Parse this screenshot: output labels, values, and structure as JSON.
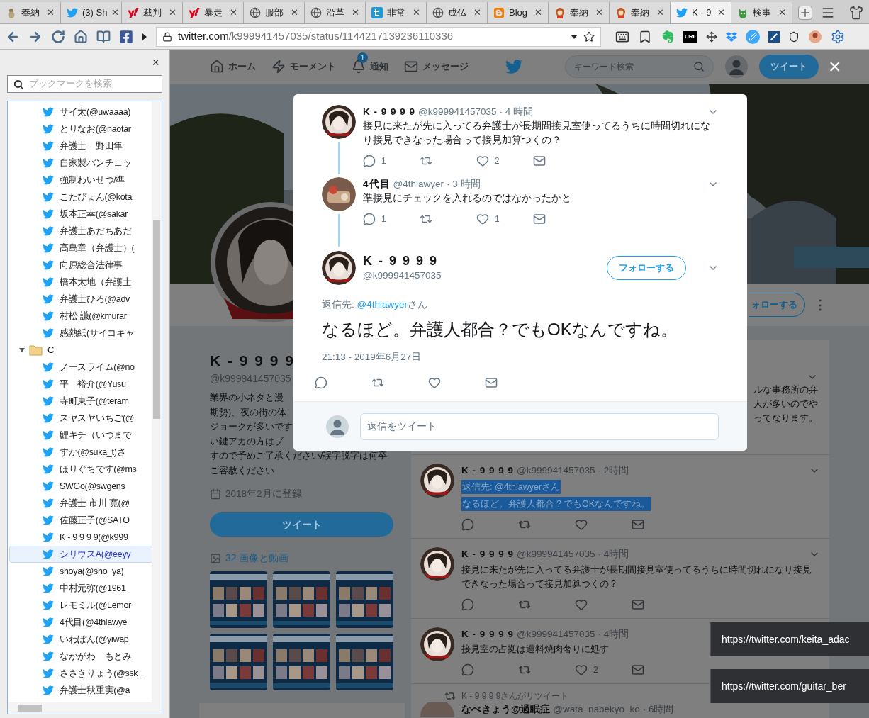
{
  "browser": {
    "tabs": [
      {
        "title": "奉納",
        "kind": "gourd",
        "close": "✕",
        "selected": false
      },
      {
        "title": "(3) Sh",
        "kind": "bird",
        "close": "✕",
        "selected": false
      },
      {
        "title": "裁判",
        "kind": "yahoo",
        "close": "✕",
        "selected": false
      },
      {
        "title": "暴走",
        "kind": "yahoo",
        "close": "✕",
        "selected": false
      },
      {
        "title": "服部",
        "kind": "globe",
        "close": "✕",
        "selected": false
      },
      {
        "title": "沿革",
        "kind": "globe",
        "close": "✕",
        "selected": false
      },
      {
        "title": "非常",
        "kind": "square",
        "close": "✕",
        "selected": false
      },
      {
        "title": "成仏",
        "kind": "globe",
        "close": "✕",
        "selected": false
      },
      {
        "title": "Blog",
        "kind": "blogger",
        "close": "✕",
        "selected": false
      },
      {
        "title": "奉納",
        "kind": "girl",
        "close": "✕",
        "selected": false
      },
      {
        "title": "奉納",
        "kind": "girl",
        "close": "✕",
        "selected": false
      },
      {
        "title": "K - 9",
        "kind": "bird",
        "close": "✕",
        "selected": true
      },
      {
        "title": "検事",
        "kind": "green",
        "close": "✕",
        "selected": false
      }
    ],
    "url": {
      "host": "twitter.com",
      "path": "/k999941457035/status/1144217139236110336"
    },
    "extension_label": "URL"
  },
  "sidebar": {
    "close": "×",
    "search_placeholder": "ブックマークを検索",
    "items": [
      {
        "kind": "bookmark",
        "label": "サイ太(@uwaaaa)",
        "selected": false
      },
      {
        "kind": "bookmark",
        "label": "とりなお(@naotar",
        "selected": false
      },
      {
        "kind": "bookmark",
        "label": "弁護士　野田隼",
        "selected": false
      },
      {
        "kind": "bookmark",
        "label": "自家製パンチェッ",
        "selected": false
      },
      {
        "kind": "bookmark",
        "label": "強制わいせつ/準",
        "selected": false
      },
      {
        "kind": "bookmark",
        "label": "こたぴょん(@kota",
        "selected": false
      },
      {
        "kind": "bookmark",
        "label": "坂本正幸(@sakar",
        "selected": false
      },
      {
        "kind": "bookmark",
        "label": "弁護士あだちあだ",
        "selected": false
      },
      {
        "kind": "bookmark",
        "label": "高島章（弁護士）(",
        "selected": false
      },
      {
        "kind": "bookmark",
        "label": "向原総合法律事",
        "selected": false
      },
      {
        "kind": "bookmark",
        "label": "橋本太地（弁護士",
        "selected": false
      },
      {
        "kind": "bookmark",
        "label": "弁護士ひろ(@adv",
        "selected": false
      },
      {
        "kind": "bookmark",
        "label": "村松 謙(@kmurar",
        "selected": false
      },
      {
        "kind": "bookmark",
        "label": "感熱紙(サイコキャ",
        "selected": false
      },
      {
        "kind": "folder",
        "label": "C",
        "expanded": true,
        "children": [
          {
            "kind": "bookmark",
            "label": "ノースライム(@no",
            "selected": false
          },
          {
            "kind": "bookmark",
            "label": "平　裕介(@Yusu",
            "selected": false
          },
          {
            "kind": "bookmark",
            "label": "寺町東子(@teram",
            "selected": false
          },
          {
            "kind": "bookmark",
            "label": "スヤスヤいちご(@",
            "selected": false
          },
          {
            "kind": "bookmark",
            "label": "鯉キチ（いつまで",
            "selected": false
          },
          {
            "kind": "bookmark",
            "label": "すか(@suka_t)さ",
            "selected": false
          },
          {
            "kind": "bookmark",
            "label": "ほりぐちです(@ms",
            "selected": false
          },
          {
            "kind": "bookmark",
            "label": "SWGo(@swgens",
            "selected": false
          },
          {
            "kind": "bookmark",
            "label": "弁護士 市川 寛(@",
            "selected": false
          },
          {
            "kind": "bookmark",
            "label": "佐藤正子(@SATO",
            "selected": false
          },
          {
            "kind": "bookmark",
            "label": "K - 9 9 9 9(@k999",
            "selected": false
          },
          {
            "kind": "bookmark",
            "label": "シリウスA(@eeyy",
            "selected": true
          },
          {
            "kind": "bookmark",
            "label": "shoya(@sho_ya)",
            "selected": false
          },
          {
            "kind": "bookmark",
            "label": "中村元弥(@1961",
            "selected": false
          },
          {
            "kind": "bookmark",
            "label": "レモミル(@Lemor",
            "selected": false
          },
          {
            "kind": "bookmark",
            "label": "4代目(@4thlawye",
            "selected": false
          },
          {
            "kind": "bookmark",
            "label": "いわぽん(@yiwap",
            "selected": false
          },
          {
            "kind": "bookmark",
            "label": "なかがわ　もとみ",
            "selected": false
          },
          {
            "kind": "bookmark",
            "label": "ささきりょう(@ssk_",
            "selected": false
          },
          {
            "kind": "bookmark",
            "label": "弁護士秋重実(@a",
            "selected": false
          }
        ]
      }
    ]
  },
  "twitter_nav": {
    "items": [
      {
        "label": "ホーム",
        "kind": "home"
      },
      {
        "label": "モーメント",
        "kind": "bolt"
      },
      {
        "label": "通知",
        "kind": "bell",
        "badge": "1"
      },
      {
        "label": "メッセージ",
        "kind": "mail"
      }
    ],
    "search_placeholder": "キーワード検索",
    "tweet_button": "ツイート",
    "close": "×"
  },
  "profile": {
    "follow_button": "ォローする",
    "more": "⋮",
    "name": "K - 9 9 9 9",
    "handle": "@k999941457035",
    "bio_lines": [
      "業界の小ネタと漫",
      "期勢)、夜の街の体",
      "ジョークが多いです",
      "い鍵アカの方はブ",
      "すので予めご了承ください/誤字脱字は何卒",
      "ご容赦ください"
    ],
    "joined": "2018年2月に登録",
    "tweet_button": "ツイート",
    "media_link": "32 画像と動画"
  },
  "timeline": {
    "hidden_fragments": [
      "ルな事務所の弁",
      "人が多いのでや",
      "ってなります。"
    ],
    "tweets": [
      {
        "name": "K - 9 9 9 9",
        "handle": "@k999941457035",
        "time": "· 2時間",
        "lines": [
          "返信先: @4thlawyerさん",
          "なるほど。弁護人都合？でもOKなんですね。"
        ],
        "highlighted": true
      },
      {
        "name": "K - 9 9 9 9",
        "handle": "@k999941457035",
        "time": "· 4時間",
        "lines": [
          "接見に来たが先に入ってる弁護士が長期間接見室使ってるうちに時間切れになり接見",
          "できなった場合って接見加算つくの？"
        ],
        "highlighted": false
      },
      {
        "name": "K - 9 9 9 9",
        "handle": "@k999941457035",
        "time": "· 4時間",
        "lines": [
          "接見室の占拠は過料焼肉奢りに処す"
        ],
        "highlighted": false,
        "likes": "2"
      }
    ],
    "retweet": {
      "note": "K - 9 9 9 9さんがリツイート",
      "name": "なべきょう@過眠症",
      "handle": "@wata_nabekyo_ko",
      "time": "· 6時間"
    }
  },
  "modal": {
    "thread": [
      {
        "name": "K - 9 9 9 9",
        "handle": "@k999941457035",
        "time": "· 4 時間",
        "text": "接見に来たが先に入ってる弁護士が長期間接見室使ってるうちに時間切れになり接見できなった場合って接見加算つくの？",
        "replies": "1",
        "likes": "2",
        "kind": "drawn"
      },
      {
        "name": "4代目",
        "handle": "@4thlawyer",
        "time": "· 3 時間",
        "text": "準接見にチェックを入れるのではなかったかと",
        "replies": "1",
        "likes": "1"
      }
    ],
    "main": {
      "name": "K - 9 9 9 9",
      "handle": "@k999941457035",
      "follow_button": "フォローする",
      "reply_prefix": "返信先: ",
      "reply_user": "@4thlawyer",
      "reply_suffix": "さん",
      "text": "なるほど。弁護人都合？でもOKなんですね。",
      "time": "21:13 - 2019年6月27日"
    },
    "reply_placeholder": "返信をツイート"
  },
  "tooltips": [
    "https://twitter.com/keita_adac",
    "https://twitter.com/guitar_ber"
  ]
}
